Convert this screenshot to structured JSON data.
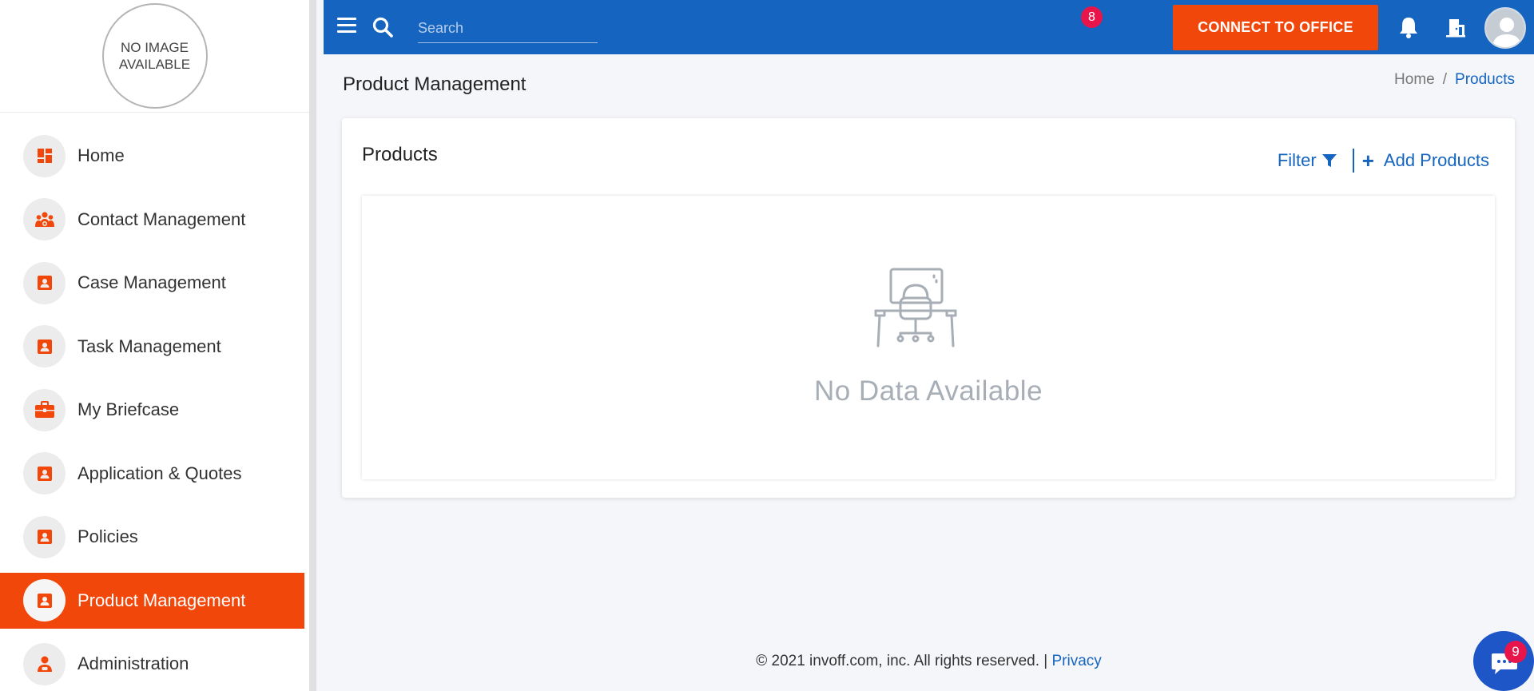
{
  "logo": {
    "text_line1": "NO IMAGE",
    "text_line2": "AVAILABLE"
  },
  "sidebar": {
    "items": [
      {
        "label": "Home",
        "icon": "dashboard-icon",
        "active": false
      },
      {
        "label": "Contact Management",
        "icon": "people-icon",
        "active": false
      },
      {
        "label": "Case Management",
        "icon": "contact-card-icon",
        "active": false
      },
      {
        "label": "Task Management",
        "icon": "contact-card-icon",
        "active": false
      },
      {
        "label": "My Briefcase",
        "icon": "briefcase-icon",
        "active": false
      },
      {
        "label": "Application & Quotes",
        "icon": "contact-card-icon",
        "active": false
      },
      {
        "label": "Policies",
        "icon": "contact-card-icon",
        "active": false
      },
      {
        "label": "Product Management",
        "icon": "contact-card-icon",
        "active": true
      },
      {
        "label": "Administration",
        "icon": "admin-user-icon",
        "active": false
      }
    ]
  },
  "topbar": {
    "search_placeholder": "Search",
    "connect_label": "CONNECT TO OFFICE",
    "notification_count": "8"
  },
  "page": {
    "title": "Product Management",
    "breadcrumb": {
      "home": "Home",
      "separator": "/",
      "current": "Products"
    }
  },
  "card": {
    "title": "Products",
    "filter_label": "Filter",
    "add_label": "Add Products",
    "empty_text": "No Data Available"
  },
  "footer": {
    "copyright": "© 2021 invoff.com, inc. All rights reserved. |",
    "privacy": "Privacy"
  },
  "chat": {
    "badge_count": "9"
  },
  "colors": {
    "brand_blue": "#1565c0",
    "accent_orange": "#f2470a",
    "badge_red": "#e8154b"
  }
}
